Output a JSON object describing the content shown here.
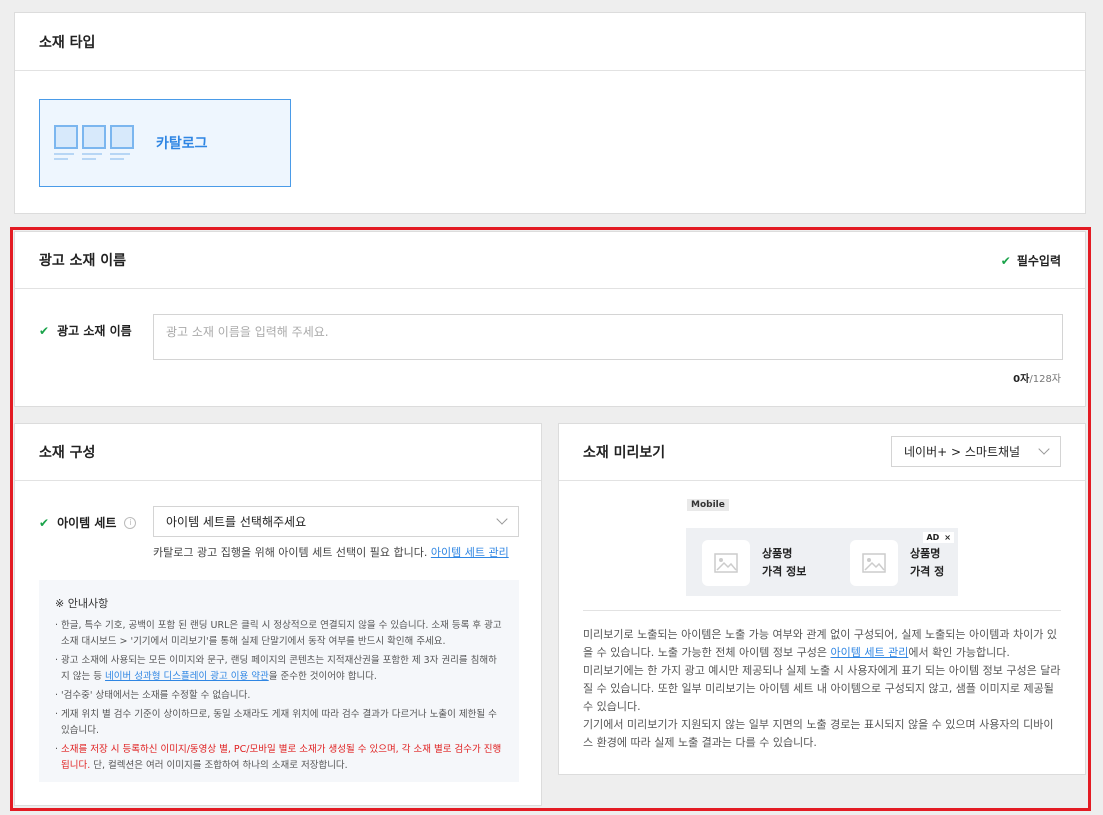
{
  "type_section": {
    "title": "소재 타입",
    "card_label": "카탈로그"
  },
  "name_section": {
    "title": "광고 소재 이름",
    "required_label": "필수입력",
    "field_label": "광고 소재 이름",
    "placeholder": "광고 소재 이름을 입력해 주세요.",
    "count": "0자",
    "max": "/128자"
  },
  "compose_section": {
    "title": "소재 구성",
    "item_set_label": "아이템 세트",
    "item_set_select": "아이템 세트를 선택해주세요",
    "help_text": "카탈로그 광고 집행을 위해 아이템 세트 선택이 필요 합니다.",
    "help_link": "아이템 세트 관리",
    "notice": {
      "title": "※ 안내사항",
      "item1": "한글, 특수 기호, 공백이 포함 된 랜딩 URL은 클릭 시 정상적으로 연결되지 않을 수 있습니다. 소재 등록 후 광고 소재 대시보드 > '기기에서 미리보기'를 통해 실제 단말기에서 동작 여부를 반드시 확인해 주세요.",
      "item2_pre": "광고 소재에 사용되는 모든 이미지와 문구, 랜딩 페이지의 콘텐츠는 지적재산권을 포함한 제 3자 권리를 침해하지 않는 등",
      "item2_link": "네이버 성과형 디스플레이 광고 이용 약관",
      "item2_post": "을 준수한 것이어야 합니다.",
      "item3": "'검수중' 상태에서는 소재를 수정할 수 없습니다.",
      "item4": "게재 위치 별 검수 기준이 상이하므로, 동일 소재라도 게재 위치에 따라 검수 결과가 다르거나 노출이 제한될 수 있습니다.",
      "item5_red": "소재를 저장 시 등록하신 이미지/동영상 별, PC/모바일 별로 소재가 생성될 수 있으며, 각 소재 별로 검수가 진행됩니다.",
      "item5_post": " 단, 컬렉션은 여러 이미지를 조합하여 하나의 소재로 저장합니다."
    }
  },
  "preview_section": {
    "title": "소재 미리보기",
    "placement_select": "네이버+ > 스마트채널",
    "device_tag": "Mobile",
    "ad_badge": "AD",
    "close_glyph": "×",
    "product1_name": "상품명",
    "product1_price": "가격 정보",
    "product2_name": "상품명",
    "product2_price": "가격 정",
    "desc1_pre": "미리보기로 노출되는 아이템은 노출 가능 여부와 관계 없이 구성되어, 실제 노출되는 아이템과 차이가 있을 수 있습니다. 노출 가능한 전체 아이템 정보 구성은",
    "desc1_link": "아이템 세트 관리",
    "desc1_post": "에서 확인 가능합니다.",
    "desc2": "미리보기에는 한 가지 광고 예시만 제공되나 실제 노출 시 사용자에게 표기 되는 아이템 정보 구성은 달라질 수 있습니다. 또한 일부 미리보기는 아이템 세트 내 아이템으로 구성되지 않고, 샘플 이미지로 제공될 수 있습니다.",
    "desc3": "기기에서 미리보기가 지원되지 않는 일부 지면의 노출 경로는 표시되지 않을 수 있으며 사용자의 디바이스 환경에 따라 실제 노출 결과는 다를 수 있습니다."
  },
  "colors": {
    "accent": "#2f86e3",
    "highlight": "#e31b23",
    "check": "#1aa34a"
  }
}
